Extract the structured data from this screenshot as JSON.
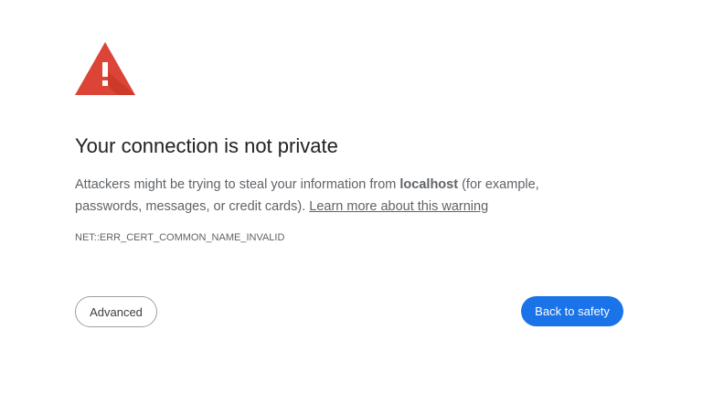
{
  "icon": {
    "name": "warning-triangle-icon",
    "color": "#db4437"
  },
  "title": "Your connection is not private",
  "message": {
    "before_host": "Attackers might be trying to steal your information from ",
    "host": "localhost",
    "after_host": " (for example, passwords, messages, or credit cards). ",
    "learn_more_link": "Learn more about this warning"
  },
  "error_code": "NET::ERR_CERT_COMMON_NAME_INVALID",
  "buttons": {
    "advanced_label": "Advanced",
    "back_to_safety_label": "Back to safety"
  },
  "colors": {
    "primary_button": "#1a73e8",
    "text_secondary": "#5f6368",
    "title_text": "#202124"
  }
}
